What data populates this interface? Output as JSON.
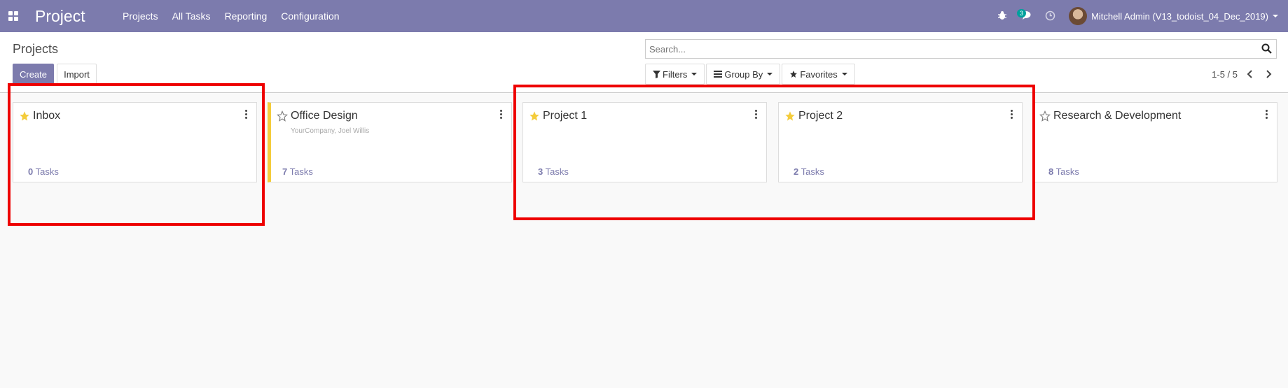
{
  "navbar": {
    "app_title": "Project",
    "menu": [
      "Projects",
      "All Tasks",
      "Reporting",
      "Configuration"
    ],
    "messages_count": "3",
    "user": "Mitchell Admin (V13_todoist_04_Dec_2019)"
  },
  "control_panel": {
    "breadcrumb": "Projects",
    "create_label": "Create",
    "import_label": "Import",
    "search_placeholder": "Search...",
    "filters_label": "Filters",
    "group_by_label": "Group By",
    "favorites_label": "Favorites",
    "pager": "1-5 / 5"
  },
  "projects": [
    {
      "name": "Inbox",
      "favorite": true,
      "subtitle": "",
      "task_count": "0",
      "tasks_label": "Tasks"
    },
    {
      "name": "Office Design",
      "favorite": false,
      "subtitle": "YourCompany, Joel Willis",
      "task_count": "7",
      "tasks_label": "Tasks",
      "color": "#f4cc3b"
    },
    {
      "name": "Project 1",
      "favorite": true,
      "subtitle": "",
      "task_count": "3",
      "tasks_label": "Tasks"
    },
    {
      "name": "Project 2",
      "favorite": true,
      "subtitle": "",
      "task_count": "2",
      "tasks_label": "Tasks"
    },
    {
      "name": "Research & Development",
      "favorite": false,
      "subtitle": "",
      "task_count": "8",
      "tasks_label": "Tasks"
    }
  ],
  "colors": {
    "brand": "#7c7bad",
    "star": "#f4cc3b",
    "highlight": "#e00000",
    "badge": "#00a09d"
  }
}
